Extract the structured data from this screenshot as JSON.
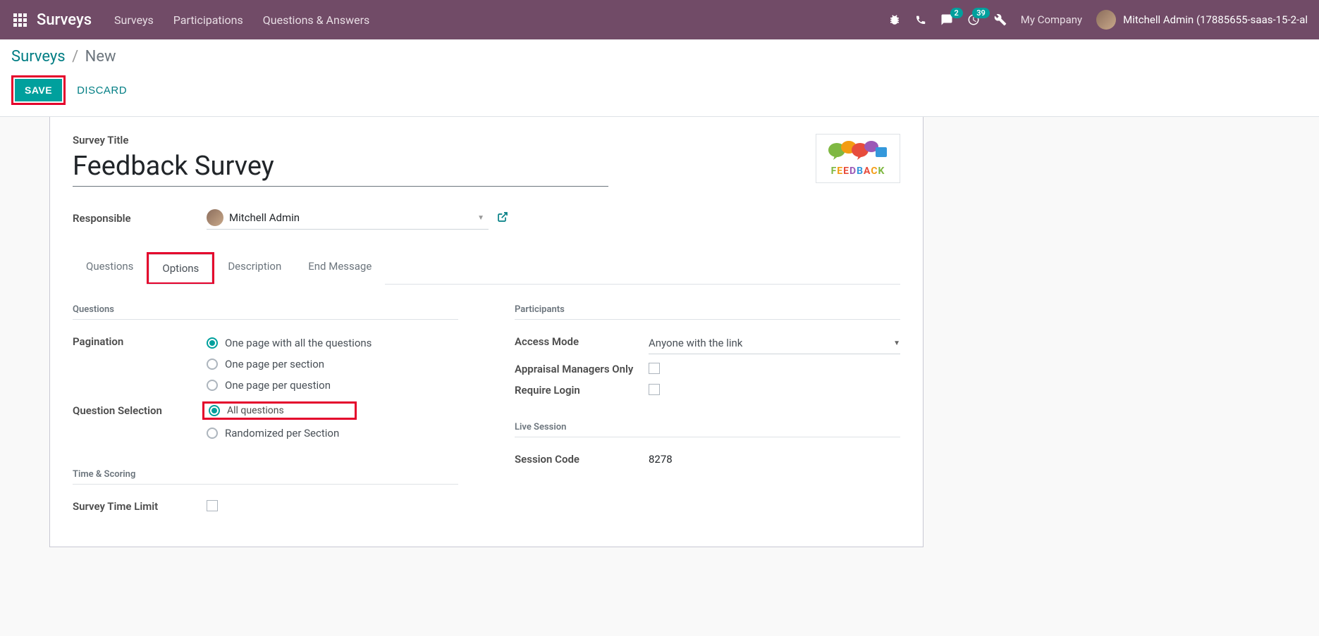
{
  "navbar": {
    "title": "Surveys",
    "menu": [
      "Surveys",
      "Participations",
      "Questions & Answers"
    ],
    "messages_badge": "2",
    "activities_badge": "39",
    "company": "My Company",
    "user": "Mitchell Admin (17885655-saas-15-2-al"
  },
  "breadcrumb": {
    "parent": "Surveys",
    "current": "New"
  },
  "actions": {
    "save": "SAVE",
    "discard": "DISCARD"
  },
  "form": {
    "title_label": "Survey Title",
    "title_value": "Feedback Survey",
    "responsible_label": "Responsible",
    "responsible_value": "Mitchell Admin",
    "feedback_logo": "FEEDBACK"
  },
  "tabs": [
    "Questions",
    "Options",
    "Description",
    "End Message"
  ],
  "options": {
    "left_sections": {
      "questions": {
        "title": "Questions",
        "pagination_label": "Pagination",
        "pagination_options": [
          "One page with all the questions",
          "One page per section",
          "One page per question"
        ],
        "selection_label": "Question Selection",
        "selection_options": [
          "All questions",
          "Randomized per Section"
        ]
      },
      "time_scoring": {
        "title": "Time & Scoring",
        "time_limit_label": "Survey Time Limit"
      }
    },
    "right_sections": {
      "participants": {
        "title": "Participants",
        "access_mode_label": "Access Mode",
        "access_mode_value": "Anyone with the link",
        "appraisal_label": "Appraisal Managers Only",
        "require_login_label": "Require Login"
      },
      "live_session": {
        "title": "Live Session",
        "session_code_label": "Session Code",
        "session_code_value": "8278"
      }
    }
  }
}
